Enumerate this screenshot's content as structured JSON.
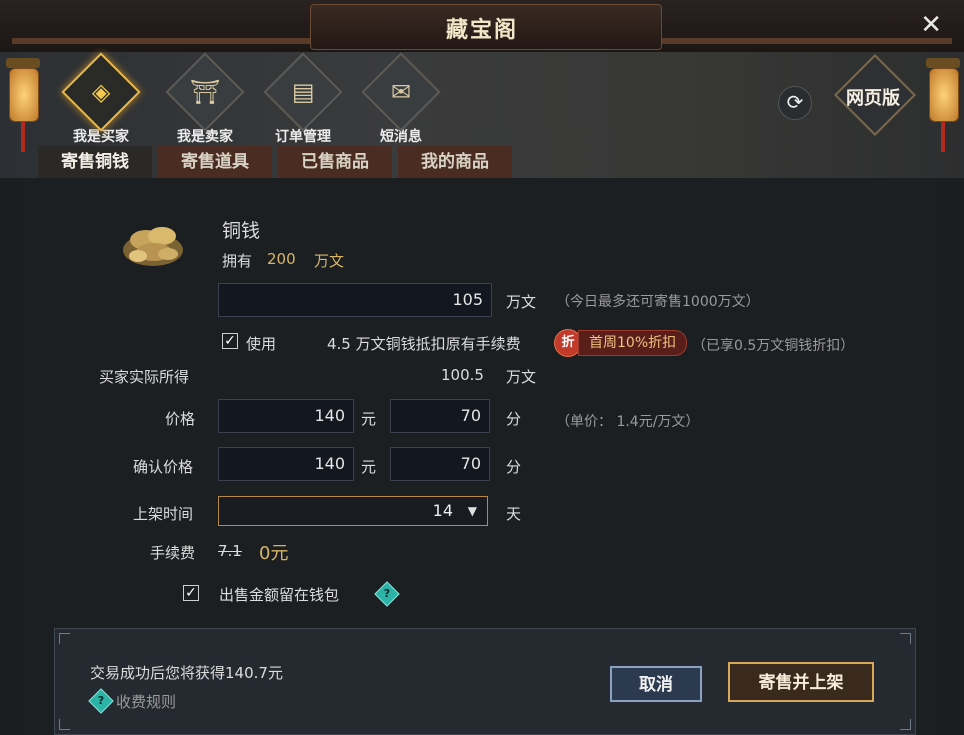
{
  "window": {
    "title": "藏宝阁"
  },
  "nav": [
    {
      "label": "我是买家",
      "icon": "coin-icon",
      "active": true
    },
    {
      "label": "我是卖家",
      "icon": "stall-icon",
      "active": false
    },
    {
      "label": "订单管理",
      "icon": "book-icon",
      "active": false
    },
    {
      "label": "短消息",
      "icon": "envelope-icon",
      "active": false
    }
  ],
  "web_version_label": "网页版",
  "tabs": [
    {
      "label": "寄售铜钱",
      "active": true
    },
    {
      "label": "寄售道具",
      "active": false
    },
    {
      "label": "已售商品",
      "active": false
    },
    {
      "label": "我的商品",
      "active": false
    }
  ],
  "item": {
    "name": "铜钱",
    "owned_label": "拥有",
    "owned_value": "200",
    "owned_unit": "万文"
  },
  "amount": {
    "value": "105",
    "unit": "万文",
    "hint": "（今日最多还可寄售1000万文）"
  },
  "use_coin": {
    "checked": true,
    "label": "使用",
    "desc": "4.5 万文铜钱抵扣原有手续费"
  },
  "promo": {
    "badge": "折",
    "text": "首周10%折扣",
    "note": "（已享0.5万文铜钱折扣）"
  },
  "buyer_gets": {
    "label": "买家实际所得",
    "value": "100.5",
    "unit": "万文"
  },
  "price": {
    "label": "价格",
    "yuan": "140",
    "yuan_unit": "元",
    "fen": "70",
    "fen_unit": "分",
    "unit_price": "（单价：  1.4元/万文）"
  },
  "confirm_price": {
    "label": "确认价格",
    "yuan": "140",
    "yuan_unit": "元",
    "fen": "70",
    "fen_unit": "分"
  },
  "listing_time": {
    "label": "上架时间",
    "value": "14",
    "unit": "天"
  },
  "fee": {
    "label": "手续费",
    "original": "7.1",
    "current": "0元"
  },
  "keep_in_wallet": {
    "checked": true,
    "label": "出售金额留在钱包"
  },
  "footer": {
    "summary": "交易成功后您将获得140.7元",
    "rules_link": "收费规则",
    "cancel": "取消",
    "submit": "寄售并上架"
  },
  "colors": {
    "accent_gold": "#d6a85a",
    "promo_red": "#c23a2a",
    "help_teal": "#2bb3a8"
  }
}
